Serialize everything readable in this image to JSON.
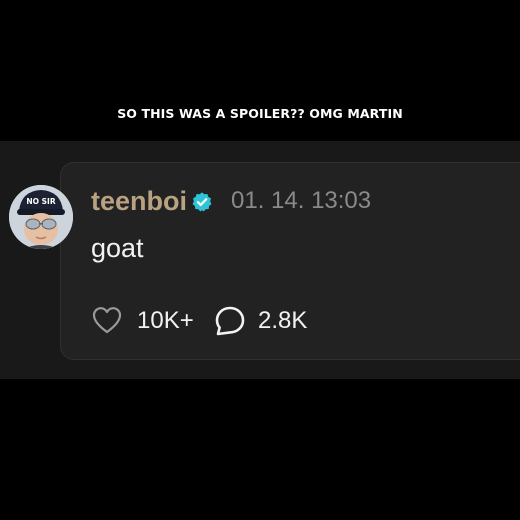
{
  "caption": "SO THIS WAS A SPOILER?? OMG MARTIN",
  "post": {
    "username": "teenboi",
    "timestamp": "01. 14. 13:03",
    "text": "goat",
    "avatar_cap_text": "NO SIR",
    "verified": true,
    "stats": {
      "likes": "10K+",
      "comments": "2.8K"
    }
  },
  "icons": {
    "verified": "verified-badge-icon",
    "like": "heart-outline-icon",
    "comment": "speech-bubble-icon"
  },
  "colors": {
    "background": "#000000",
    "band": "#191919",
    "card": "#222222",
    "username": "#b8a282",
    "verified": "#2ec4d6",
    "timestamp": "#8a8a8a",
    "text": "#f2f2f2",
    "icon": "#9a9a9a"
  }
}
